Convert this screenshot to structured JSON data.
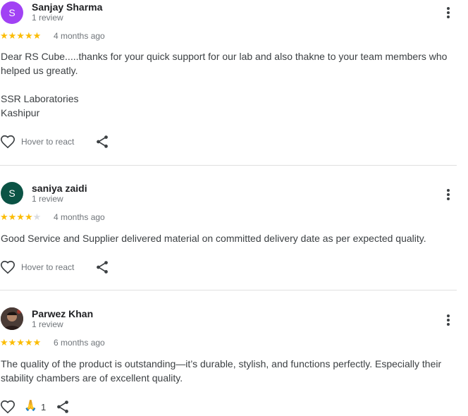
{
  "reviews": [
    {
      "author": "Sanjay Sharma",
      "avatar_letter": "S",
      "avatar_color": "#a142f4",
      "review_count": "1 review",
      "rating": 5,
      "stars_text": "★★★★★",
      "stars_empty": "",
      "date": "4 months ago",
      "text_lines": [
        "Dear RS Cube.....thanks for your quick support for our lab and also thakne to your team members who helped us greatly.",
        "SSR Laboratories",
        "Kashipur"
      ],
      "react_label": "Hover to react"
    },
    {
      "author": "saniya zaidi",
      "avatar_letter": "S",
      "avatar_color": "#0b5345",
      "review_count": "1 review",
      "rating": 4,
      "stars_text": "★★★★",
      "stars_empty": "★",
      "date": "4 months ago",
      "text": "Good Service and Supplier delivered material on committed delivery date as per expected quality.",
      "react_label": "Hover to react"
    },
    {
      "author": "Parwez Khan",
      "avatar_photo": true,
      "review_count": "1 review",
      "rating": 5,
      "stars_text": "★★★★★",
      "stars_empty": "",
      "date": "6 months ago",
      "text": "The quality of the product is outstanding—it’s durable, stylish, and functions perfectly. Especially their stability chambers are of excellent quality.",
      "reaction_emoji": "🙏",
      "reaction_count": "1"
    }
  ],
  "colors": {
    "star": "#fbbc04",
    "star_empty": "#dadce0",
    "divider": "#e0e0e0"
  }
}
